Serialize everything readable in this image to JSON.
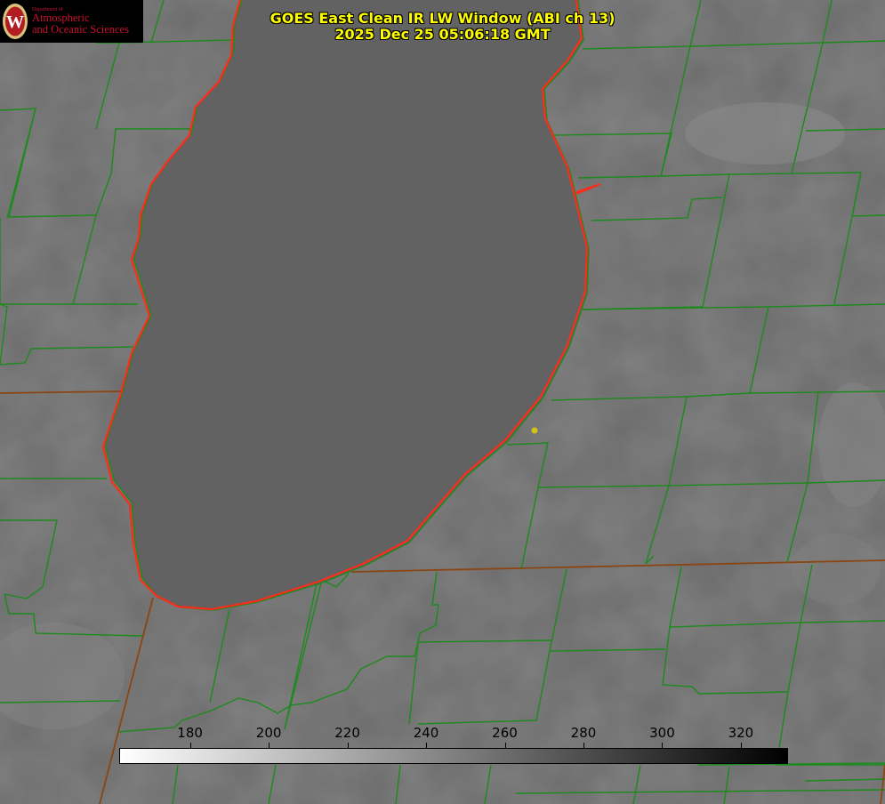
{
  "logo": {
    "department": "Department of",
    "line1": "Atmospheric",
    "line2": "and Oceanic Sciences",
    "seal_letter": "W"
  },
  "title": {
    "line1": "GOES East Clean IR LW Window (ABI ch 13)",
    "line2": "2025 Dec 25 05:06:18 GMT"
  },
  "colorbar": {
    "ticks": [
      "180",
      "200",
      "220",
      "240",
      "260",
      "280",
      "300",
      "320"
    ],
    "tick_values": [
      180,
      200,
      220,
      240,
      260,
      280,
      300,
      320
    ],
    "range": [
      162,
      332
    ]
  },
  "colors": {
    "lake_outline": "#ff2a1a",
    "county_lines": "#1c8a1c",
    "state_lines": "#8b4513",
    "title_text": "#ffff00",
    "marker": "#d4c21a"
  }
}
